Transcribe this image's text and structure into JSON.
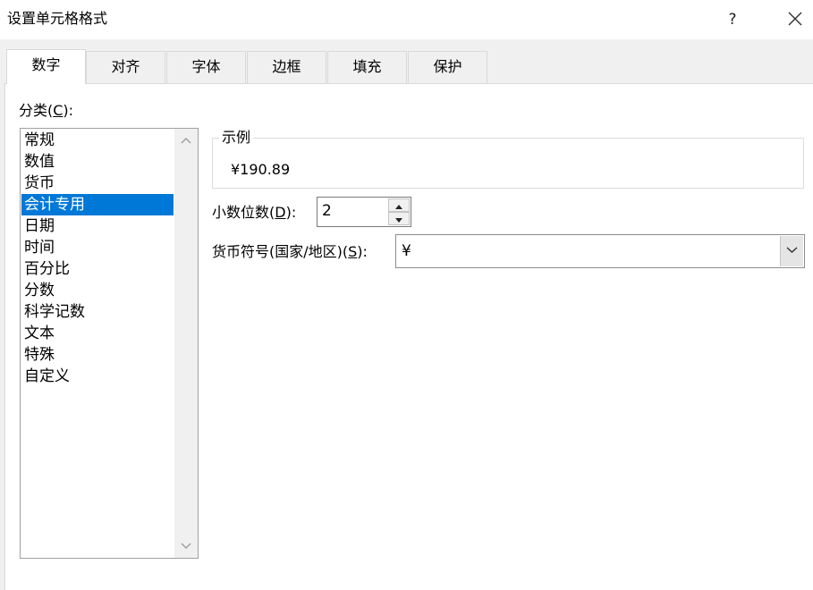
{
  "window": {
    "title": "设置单元格格式",
    "help_label": "?"
  },
  "tabs": [
    {
      "label": "数字",
      "active": true
    },
    {
      "label": "对齐",
      "active": false
    },
    {
      "label": "字体",
      "active": false
    },
    {
      "label": "边框",
      "active": false
    },
    {
      "label": "填充",
      "active": false
    },
    {
      "label": "保护",
      "active": false
    }
  ],
  "category": {
    "label_pre": "分类(",
    "label_key": "C",
    "label_post": "):",
    "selected": "会计专用",
    "items": [
      "常规",
      "数值",
      "货币",
      "会计专用",
      "日期",
      "时间",
      "百分比",
      "分数",
      "科学记数",
      "文本",
      "特殊",
      "自定义"
    ]
  },
  "sample": {
    "legend": "示例",
    "value": "¥190.89"
  },
  "decimal_places": {
    "label_pre": "小数位数(",
    "label_key": "D",
    "label_post": "):",
    "value": "2"
  },
  "currency_symbol": {
    "label_pre": "货币符号(国家/地区)(",
    "label_key": "S",
    "label_post": "):",
    "value": "¥"
  },
  "icons": {
    "close": "close-icon",
    "spin_up": "triangle-up-icon",
    "spin_down": "triangle-down-icon",
    "dropdown": "chevron-down-icon",
    "scroll_up": "chevron-up-icon",
    "scroll_down": "chevron-down-icon"
  },
  "colors": {
    "selection": "#0078d7",
    "dialog_bg": "#f0f0f0",
    "panel_bg": "#ffffff"
  }
}
